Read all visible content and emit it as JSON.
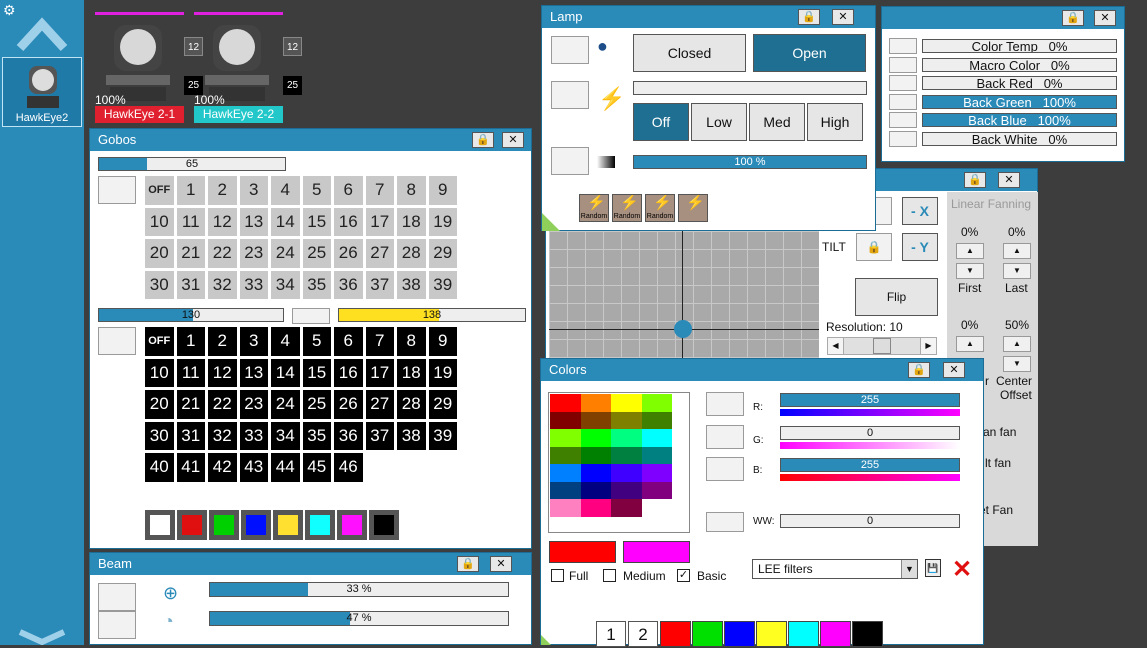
{
  "sidebar": {
    "fixture_label": "HawkEye2",
    "gear_icon": "gear-icon"
  },
  "fixtures": [
    {
      "name": "HawkEye 2-1",
      "pct": "100%",
      "n1": "12",
      "n2": "25",
      "color": "#e0202e"
    },
    {
      "name": "HawkEye 2-2",
      "pct": "100%",
      "n1": "12",
      "n2": "25",
      "color": "#21c7c9"
    }
  ],
  "gobos": {
    "title": "Gobos",
    "bar1": "65",
    "bar1_frac": 0.26,
    "grid1": [
      "OFF",
      "1",
      "2",
      "3",
      "4",
      "5",
      "6",
      "7",
      "8",
      "9",
      "10",
      "11",
      "12",
      "13",
      "14",
      "15",
      "16",
      "17",
      "18",
      "19",
      "20",
      "21",
      "22",
      "23",
      "24",
      "25",
      "26",
      "27",
      "28",
      "29",
      "30",
      "31",
      "32",
      "33",
      "34",
      "35",
      "36",
      "37",
      "38",
      "39"
    ],
    "bar2": "130",
    "bar2_frac": 0.51,
    "bar3": "138",
    "bar3_frac": 0.54,
    "grid2": [
      "OFF",
      "1",
      "2",
      "3",
      "4",
      "5",
      "6",
      "7",
      "8",
      "9",
      "10",
      "11",
      "12",
      "13",
      "14",
      "15",
      "16",
      "17",
      "18",
      "19",
      "20",
      "21",
      "22",
      "23",
      "24",
      "25",
      "26",
      "27",
      "28",
      "29",
      "30",
      "31",
      "32",
      "33",
      "34",
      "35",
      "36",
      "37",
      "38",
      "39",
      "40",
      "41",
      "42",
      "43",
      "44",
      "45",
      "46"
    ],
    "colors": [
      "#ffffff",
      "#e01010",
      "#00d000",
      "#0010ff",
      "#ffe030",
      "#10ffff",
      "#ff10ff",
      "#000000"
    ]
  },
  "beam": {
    "title": "Beam",
    "bar1": "33 %",
    "bar1_frac": 0.33,
    "bar2": "47 %",
    "bar2_frac": 0.47
  },
  "lamp": {
    "title": "Lamp",
    "closed": "Closed",
    "open": "Open",
    "levels": [
      "Off",
      "Low",
      "Med",
      "High"
    ],
    "dimmer": "100 %",
    "dimmer_frac": 1.0,
    "random_labels": [
      "Random",
      "Random",
      "Random",
      ""
    ]
  },
  "extra": {
    "rows": [
      {
        "label": "Color Temp",
        "value": "0%",
        "frac": 0
      },
      {
        "label": "Macro Color",
        "value": "0%",
        "frac": 0
      },
      {
        "label": "Back Red",
        "value": "0%",
        "frac": 0
      },
      {
        "label": "Back Green",
        "value": "100%",
        "frac": 1
      },
      {
        "label": "Back Blue",
        "value": "100%",
        "frac": 1
      },
      {
        "label": "Back White",
        "value": "0%",
        "frac": 0
      }
    ]
  },
  "position": {
    "minus_x": "- X",
    "minus_y": "- Y",
    "tilt": "TILT",
    "flip": "Flip",
    "resolution": "Resolution: 10",
    "linear_fanning": "Linear Fanning",
    "first_pct": "0%",
    "last_pct": "0%",
    "first": "First",
    "last": "Last",
    "pct3": "0%",
    "pct4": "50%",
    "r_label": "r",
    "center_offset_1": "Center",
    "center_offset_2": "Offset",
    "pan_fan": "an fan",
    "tilt_fan": "lt fan",
    "set_fan": "et Fan"
  },
  "colors": {
    "title": "Colors",
    "r": "R:",
    "g": "G:",
    "b": "B:",
    "ww": "WW:",
    "r_val": "255",
    "g_val": "0",
    "b_val": "255",
    "ww_val": "0",
    "r_frac": 1.0,
    "g_frac": 0.0,
    "b_frac": 1.0,
    "ww_frac": 0.0,
    "palette": [
      "#ff0000",
      "#ff8000",
      "#ffff00",
      "#80ff00",
      "#800000",
      "#804000",
      "#808000",
      "#408000",
      "#80ff00",
      "#00ff00",
      "#00ff80",
      "#00ffff",
      "#408000",
      "#008000",
      "#008040",
      "#008080",
      "#0080ff",
      "#0000ff",
      "#4000ff",
      "#8000ff",
      "#004080",
      "#000080",
      "#400080",
      "#800080",
      "#ff80c0",
      "#ff0080",
      "#800040",
      "#ffffff"
    ],
    "preview1": "#ff0000",
    "preview2": "#ff00ff",
    "filter_full": "Full",
    "filter_medium": "Medium",
    "filter_basic": "Basic",
    "lee": "LEE filters",
    "pages": [
      "1",
      "2"
    ],
    "quick": [
      "#ff0000",
      "#00e000",
      "#0000ff",
      "#ffff20",
      "#00ffff",
      "#ff00ff",
      "#000000"
    ]
  }
}
